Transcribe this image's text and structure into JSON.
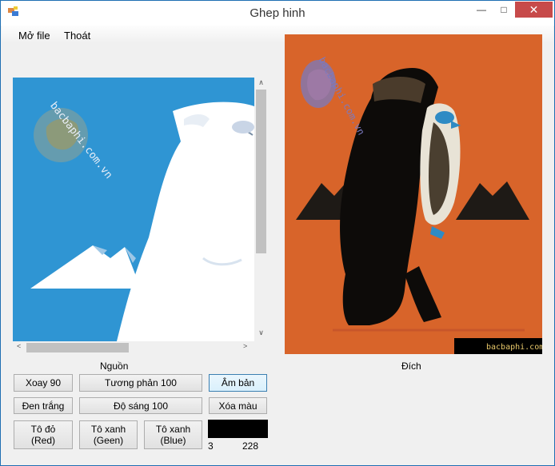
{
  "window": {
    "title": "Ghep hinh",
    "min_glyph": "—",
    "max_glyph": "□",
    "close_glyph": "✕"
  },
  "menu": {
    "items": [
      "Mở file",
      "Thoát"
    ]
  },
  "source": {
    "label": "Nguồn",
    "watermark": "bacbaphi.com.vn"
  },
  "dest": {
    "label": "Đích",
    "watermark": "bacbaphi.com.vn"
  },
  "buttons": {
    "rotate": "Xoay 90",
    "contrast": "Tương phản 100",
    "negative": "Âm bản",
    "bw": "Đen trắng",
    "brightness": "Độ sáng 100",
    "clear_color": "Xóa màu",
    "red_line1": "Tô đỏ",
    "red_line2": "(Red)",
    "green_line1": "Tô xanh",
    "green_line2": "(Geen)",
    "blue_line1": "Tô xanh",
    "blue_line2": "(Blue)"
  },
  "color_preview": {
    "color": "#000000",
    "left_value": "3",
    "right_value": "228"
  },
  "colors": {
    "source_bg": "#2f95d3",
    "dest_bg": "#d8642a",
    "close_btn": "#c74a4a"
  },
  "scrollbars": {
    "up_arrow": "∧",
    "down_arrow": "∨",
    "left_arrow": "<",
    "right_arrow": ">"
  }
}
